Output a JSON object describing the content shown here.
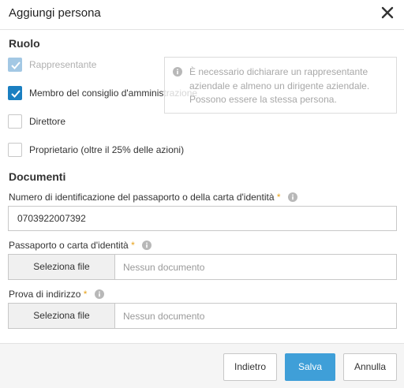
{
  "dialog": {
    "title": "Aggiungi persona"
  },
  "role": {
    "section_title": "Ruolo",
    "options": [
      {
        "label": "Rappresentante",
        "checked": true,
        "disabled": true
      },
      {
        "label": "Membro del consiglio d'amministrazione",
        "checked": true,
        "disabled": false
      },
      {
        "label": "Direttore",
        "checked": false,
        "disabled": false
      },
      {
        "label": "Proprietario (oltre il 25% delle azioni)",
        "checked": false,
        "disabled": false
      }
    ],
    "info_text": "È necessario dichiarare un rappresentante aziendale e almeno un dirigente aziendale. Possono essere la stessa persona."
  },
  "documents": {
    "section_title": "Documenti",
    "id_number": {
      "label": "Numero di identificazione del passaporto o della carta d'identità",
      "required_mark": "*",
      "value": "0703922007392"
    },
    "passport": {
      "label": "Passaporto o carta d'identità",
      "required_mark": "*",
      "button_label": "Seleziona file",
      "status": "Nessun documento"
    },
    "address_proof": {
      "label": "Prova di indirizzo",
      "required_mark": "*",
      "button_label": "Seleziona file",
      "status": "Nessun documento"
    }
  },
  "footer": {
    "back_label": "Indietro",
    "save_label": "Salva",
    "cancel_label": "Annulla"
  },
  "colors": {
    "accent": "#1a7fc1",
    "primary_button": "#3f9fd8",
    "required": "#e8a21a"
  }
}
